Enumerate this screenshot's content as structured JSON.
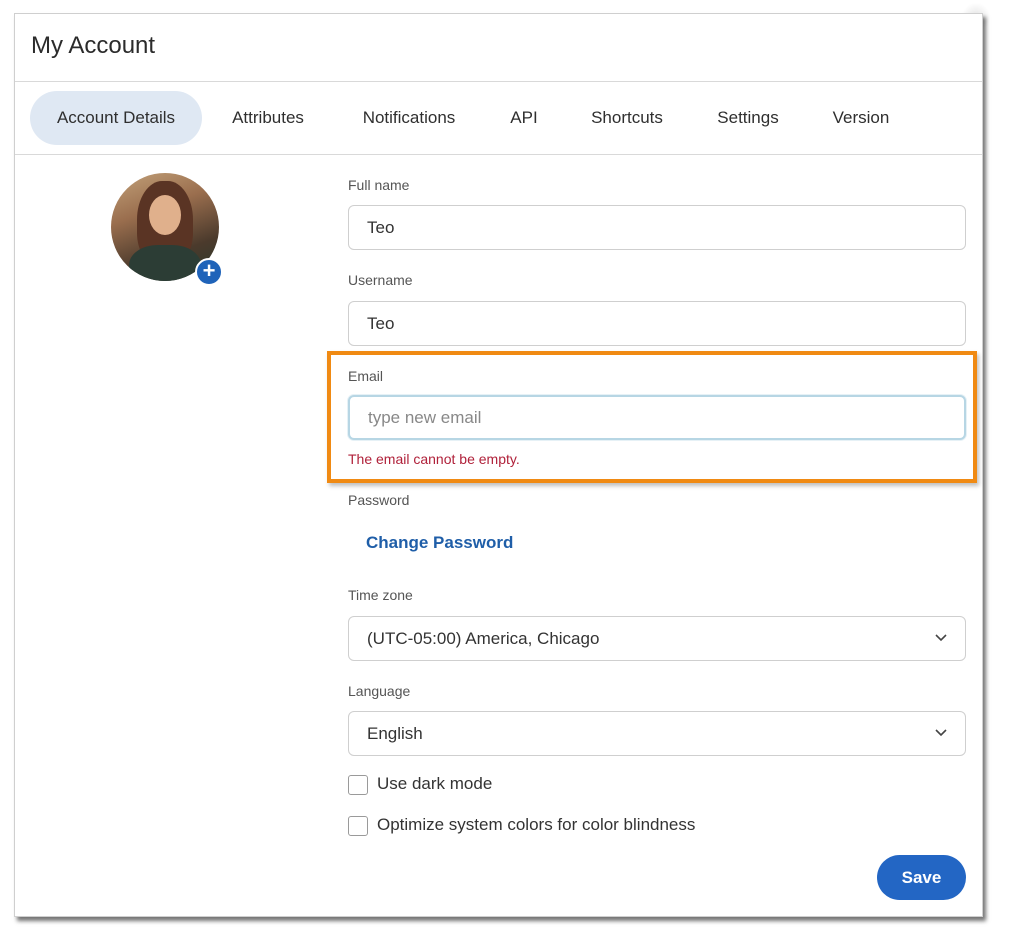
{
  "dialog": {
    "title": "My Account"
  },
  "tabs": [
    {
      "label": "Account Details",
      "active": true
    },
    {
      "label": "Attributes"
    },
    {
      "label": "Notifications"
    },
    {
      "label": "API"
    },
    {
      "label": "Shortcuts"
    },
    {
      "label": "Settings"
    },
    {
      "label": "Version"
    }
  ],
  "avatar": {
    "add_icon": "plus-circle-icon",
    "add_glyph": "+"
  },
  "form": {
    "full_name": {
      "label": "Full name",
      "value": "Teo"
    },
    "username": {
      "label": "Username",
      "value": "Teo"
    },
    "email": {
      "label": "Email",
      "value": "",
      "placeholder": "type new email",
      "error": "The email cannot be empty."
    },
    "password": {
      "label": "Password",
      "link": "Change Password"
    },
    "time_zone": {
      "label": "Time zone",
      "value": "(UTC-05:00) America, Chicago"
    },
    "language": {
      "label": "Language",
      "value": "English"
    },
    "dark_mode": {
      "label": "Use dark mode",
      "checked": false
    },
    "color_blindness": {
      "label": "Optimize system colors for color blindness",
      "checked": false
    },
    "save_label": "Save"
  },
  "colors": {
    "accent": "#2366c4",
    "active_tab_bg": "#dfe8f3",
    "error": "#b0213a",
    "highlight": "#f08a13"
  }
}
